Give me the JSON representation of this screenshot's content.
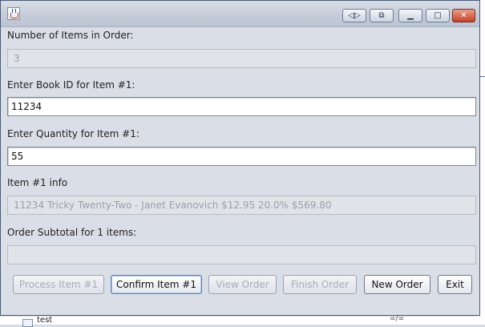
{
  "background": {
    "bottom_text": "test",
    "right_text": "=/="
  },
  "window": {
    "title_buttons": {
      "arrows": "◁▷",
      "restore": "⧉",
      "minimize": "▁",
      "maximize": "□",
      "close": "✕"
    }
  },
  "form": {
    "items_label": "Number of Items in Order:",
    "items_value": "3",
    "book_id_label": "Enter Book ID for Item #1:",
    "book_id_value": "11234",
    "quantity_label": "Enter Quantity for Item #1:",
    "quantity_value": "55",
    "item_info_label": "Item #1 info",
    "item_info_value": "11234   Tricky Twenty-Two  -  Janet Evanovich  $12.95 20.0% $569.80",
    "subtotal_label": "Order Subtotal for 1 items:",
    "subtotal_value": ""
  },
  "buttons": {
    "process": "Process Item #1",
    "confirm": "Confirm Item #1",
    "view": "View Order",
    "finish": "Finish Order",
    "new_order": "New Order",
    "exit": "Exit"
  }
}
